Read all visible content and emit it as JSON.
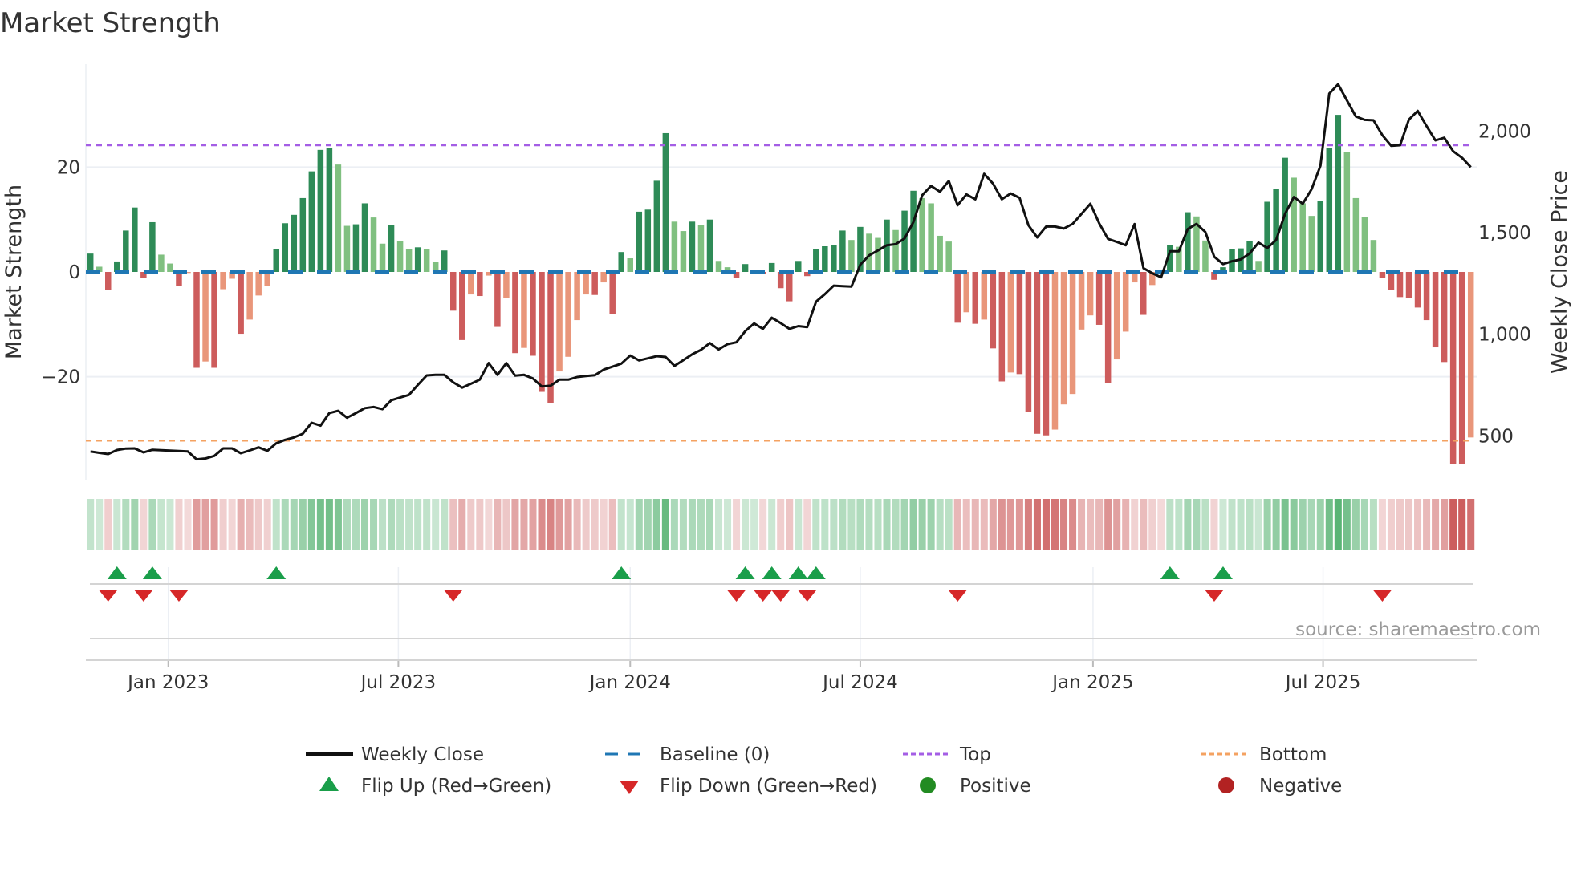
{
  "title": "Market Strength",
  "source_note": "source: sharemaestro.com",
  "colors": {
    "strong_up": "#2e8b57",
    "weak_up": "#80c080",
    "strong_down": "#cd5c5c",
    "weak_down": "#e9967a",
    "top": "#a45ee5",
    "bottom": "#f4a261",
    "baseline": "#1f77b4",
    "flip_up": "#1a9e4a",
    "flip_down": "#d62728",
    "positive": "#228b22",
    "negative": "#b22222",
    "close": "#111111"
  },
  "legend": {
    "weekly_close": "Weekly Close",
    "baseline": "Baseline (0)",
    "top": "Top",
    "bottom": "Bottom",
    "flip_up": "Flip Up (Red→Green)",
    "flip_down": "Flip Down (Green→Red)",
    "positive": "Positive",
    "negative": "Negative"
  },
  "chart_data": {
    "type": "bar",
    "title": "Market Strength",
    "ylabel": "Market Strength",
    "y2label": "Weekly Close Price",
    "ylim": [
      -39,
      37
    ],
    "y2lim": [
      300,
      2300
    ],
    "y_ticks": [
      {
        "value": 20,
        "label": "20"
      },
      {
        "value": 0,
        "label": "0"
      },
      {
        "value": -20,
        "label": "−20"
      }
    ],
    "y2_ticks": [
      {
        "value": 2000,
        "label": "2,000"
      },
      {
        "value": 1500,
        "label": "1,500"
      },
      {
        "value": 1000,
        "label": "1,000"
      },
      {
        "value": 500,
        "label": "500"
      }
    ],
    "x_ticks": [
      {
        "label": "Jan 2023",
        "week_index": 8.8
      },
      {
        "label": "Jul 2023",
        "week_index": 34.8
      },
      {
        "label": "Jan 2024",
        "week_index": 61.0
      },
      {
        "label": "Jul 2024",
        "week_index": 87.0
      },
      {
        "label": "Jan 2025",
        "week_index": 113.3
      },
      {
        "label": "Jul 2025",
        "week_index": 139.3
      }
    ],
    "top_level": 24.2,
    "bottom_level": -32.2,
    "baseline": 0,
    "grid": true,
    "legend_position": "bottom",
    "strength": [
      3.5,
      1,
      -3.4,
      2,
      7.9,
      12.3,
      -1.2,
      9.5,
      3.3,
      1.6,
      -2.7,
      -0.2,
      -18.3,
      -17.1,
      -18.3,
      -3.3,
      -1.3,
      -11.8,
      -9.1,
      -4.5,
      -2.7,
      4.4,
      9.3,
      10.9,
      14.1,
      19.2,
      23.3,
      23.7,
      20.5,
      8.8,
      9.1,
      13.1,
      10.4,
      5.4,
      8.9,
      5.9,
      4.3,
      4.7,
      4.4,
      1.9,
      4.1,
      -7.4,
      -13,
      -4.3,
      -4.6,
      -0.7,
      -10.5,
      -5,
      -15.5,
      -14.5,
      -16,
      -22.9,
      -25,
      -19,
      -16.2,
      -9.2,
      -4.3,
      -4.4,
      -2,
      -8.1,
      3.8,
      2.6,
      11.5,
      11.9,
      17.4,
      26.5,
      9.6,
      7.8,
      9.6,
      9,
      10,
      2.1,
      0.9,
      -1.2,
      1.5,
      0.3,
      -0.4,
      1.7,
      -3.1,
      -5.6,
      2.1,
      -0.8,
      4.4,
      4.9,
      5.2,
      7.9,
      6.1,
      8.6,
      7.3,
      6.5,
      10,
      8,
      11.7,
      15.5,
      14.1,
      13.1,
      6.9,
      5.8,
      -9.7,
      -7.7,
      -9.9,
      -9.1,
      -14.6,
      -20.9,
      -19.2,
      -19.5,
      -26.7,
      -30.9,
      -31.2,
      -30.1,
      -25.3,
      -23.3,
      -11,
      -8.3,
      -10.1,
      -21.2,
      -16.7,
      -11.4,
      -2,
      -8.2,
      -2.5,
      -0.2,
      5.2,
      4.8,
      11.4,
      10.6,
      6,
      -1.5,
      0.9,
      4.3,
      4.5,
      5.9,
      2.1,
      13.4,
      15.8,
      21.8,
      18,
      13.1,
      10.7,
      13.6,
      23.6,
      30,
      22.9,
      14.1,
      10.5,
      6.1,
      -1.2,
      -3.4,
      -4.8,
      -5,
      -6.8,
      -9.2,
      -14.4,
      -17.2,
      -36.6,
      -36.7,
      -31.6
    ],
    "weekly_close": [
      423,
      416,
      410,
      430,
      437,
      438,
      418,
      431,
      429,
      427,
      425,
      423,
      384,
      388,
      401,
      438,
      438,
      414,
      428,
      443,
      426,
      463,
      480,
      492,
      510,
      564,
      550,
      612,
      623,
      589,
      612,
      636,
      642,
      631,
      675,
      688,
      701,
      750,
      797,
      800,
      800,
      763,
      737,
      756,
      776,
      858,
      800,
      858,
      796,
      800,
      782,
      743,
      746,
      776,
      776,
      789,
      794,
      798,
      826,
      840,
      855,
      895,
      871,
      881,
      892,
      888,
      844,
      872,
      901,
      923,
      956,
      925,
      951,
      960,
      1015,
      1053,
      1026,
      1081,
      1055,
      1026,
      1040,
      1035,
      1160,
      1197,
      1239,
      1236,
      1234,
      1342,
      1388,
      1412,
      1438,
      1443,
      1471,
      1552,
      1684,
      1730,
      1701,
      1754,
      1635,
      1688,
      1664,
      1789,
      1741,
      1664,
      1693,
      1671,
      1537,
      1476,
      1530,
      1530,
      1520,
      1543,
      1592,
      1642,
      1546,
      1469,
      1454,
      1438,
      1542,
      1325,
      1300,
      1280,
      1408,
      1408,
      1517,
      1543,
      1503,
      1381,
      1345,
      1359,
      1368,
      1397,
      1451,
      1424,
      1464,
      1592,
      1675,
      1642,
      1713,
      1829,
      2184,
      2230,
      2151,
      2072,
      2055,
      2053,
      1980,
      1927,
      1930,
      2056,
      2099,
      2024,
      1954,
      1967,
      1901,
      1868,
      1822
    ]
  }
}
